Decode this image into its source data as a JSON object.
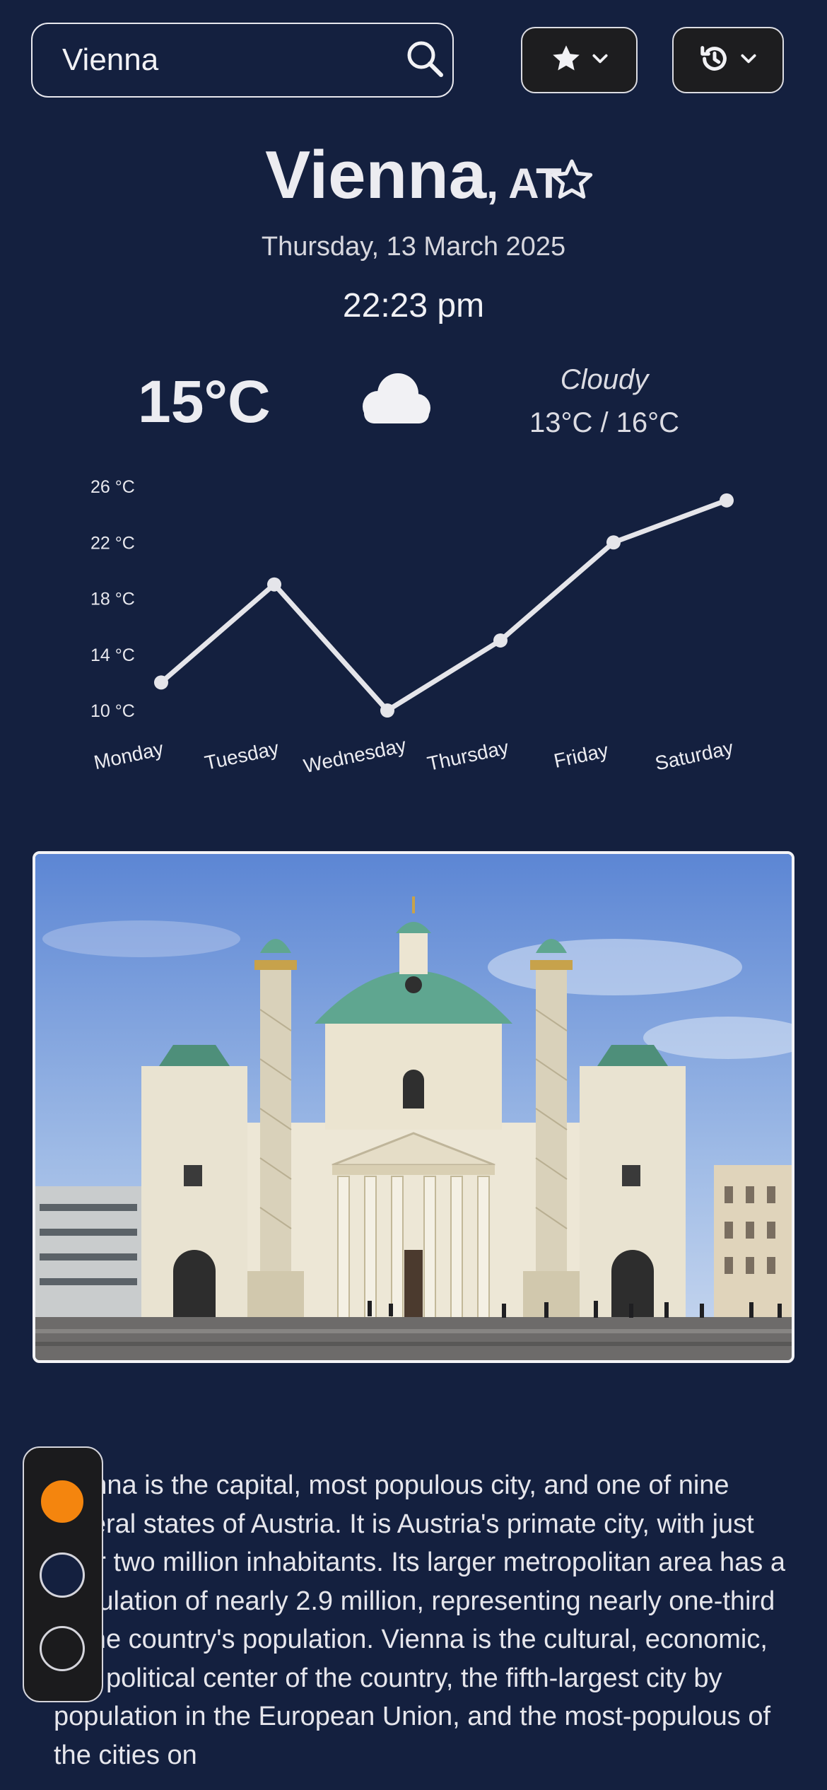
{
  "search": {
    "value": "Vienna",
    "icon": "search-icon"
  },
  "buttons": {
    "favorites": {
      "icon": "star-icon",
      "chevron": "chevron-down-icon"
    },
    "history": {
      "icon": "history-icon",
      "chevron": "chevron-down-icon"
    }
  },
  "location": {
    "city": "Vienna",
    "country": ", AT",
    "favorite_icon": "star-outline-icon"
  },
  "date": "Thursday, 13 March 2025",
  "time": "22:23 pm",
  "weather": {
    "temperature": "15°C",
    "condition": "Cloudy",
    "range": "13°C / 16°C",
    "icon": "cloud-icon"
  },
  "chart_data": {
    "type": "line",
    "categories": [
      "Monday",
      "Tuesday",
      "Wednesday",
      "Thursday",
      "Friday",
      "Saturday"
    ],
    "values": [
      12,
      19,
      10,
      15,
      22,
      25
    ],
    "yticks": [
      "26 °C",
      "22 °C",
      "18 °C",
      "14 °C",
      "10 °C"
    ],
    "ylim": [
      10,
      26
    ],
    "grid": false,
    "line_color": "#e5e5ea"
  },
  "photo": {
    "subject": "Karlskirche"
  },
  "description": "Vienna is the capital, most populous city, and one of nine federal states of Austria. It is Austria's primate city, with just over two million inhabitants. Its larger metropolitan area has a population of nearly 2.9 million, representing nearly one-third of the country's population. Vienna is the cultural, economic, and political center of the country, the fifth-largest city by population in the European Union, and the most-populous of the cities on",
  "theme_options": [
    {
      "name": "orange",
      "color": "#f4850e"
    },
    {
      "name": "navy",
      "color": "#14203f"
    },
    {
      "name": "black",
      "color": "#1b1b1d"
    }
  ]
}
